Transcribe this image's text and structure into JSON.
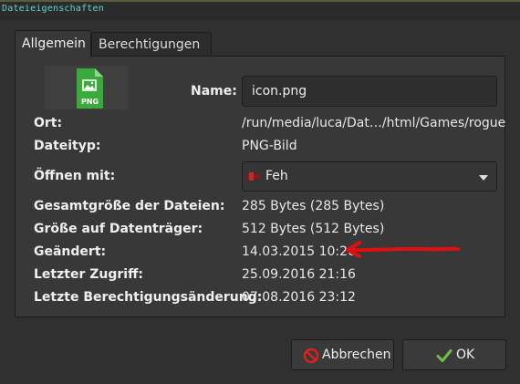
{
  "window": {
    "title": "Dateieigenschaften"
  },
  "tabs": [
    {
      "label": "Allgemein",
      "active": true
    },
    {
      "label": "Berechtigungen",
      "active": false
    }
  ],
  "file": {
    "icon_name": "png-image-file-icon",
    "icon_text": "PNG",
    "icon_color": "#3aaa3a"
  },
  "fields": {
    "name_label": "Name:",
    "name_value": "icon.png",
    "location_label": "Ort:",
    "location_value": "/run/media/luca/Dat…/html/Games/rogue",
    "filetype_label": "Dateityp:",
    "filetype_value": "PNG-Bild",
    "openwith_label": "Öffnen mit:",
    "openwith_value": "Feh",
    "totalsize_label": "Gesamtgröße der Dateien:",
    "totalsize_value": "285 Bytes (285 Bytes)",
    "disksize_label": "Größe auf Datenträger:",
    "disksize_value": "512 Bytes (512 Bytes)",
    "modified_label": "Geändert:",
    "modified_value": "14.03.2015 10:20",
    "accessed_label": "Letzter Zugriff:",
    "accessed_value": "25.09.2016 21:16",
    "permchange_label": "Letzte Berechtigungsänderung:",
    "permchange_value": "07.08.2016 23:12"
  },
  "buttons": {
    "cancel_label": "Abbrechen",
    "ok_label": "OK"
  },
  "colors": {
    "accent_annotation": "#e01010",
    "cancel_icon": "#e02020",
    "ok_icon": "#6cc04a"
  }
}
